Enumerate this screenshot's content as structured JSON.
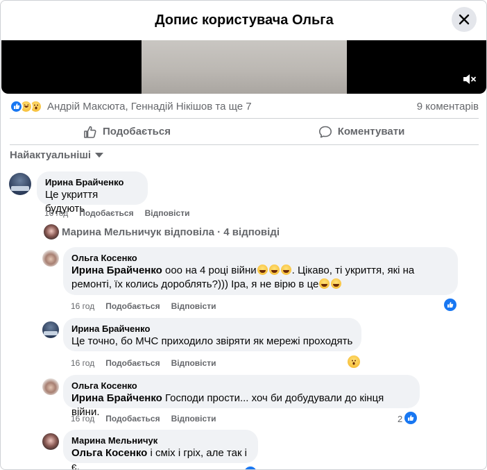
{
  "header": {
    "title": "Допис користувача Ольга"
  },
  "post": {
    "reactors": "Андрій Максюта, Геннадій Нікішов та ще 7",
    "comments_count": "9 коментарів",
    "actions": {
      "like": "Подобається",
      "comment": "Коментувати"
    },
    "sort_label": "Найактуальніші",
    "reaction_icons": [
      "like-icon",
      "laugh-icon",
      "wow-icon"
    ]
  },
  "comments": [
    {
      "author": "Ирина Брайченко",
      "text": "Це укриття будують",
      "time": "16 год",
      "like_label": "Подобається",
      "reply_label": "Відповісти"
    }
  ],
  "replies_summary": "Марина Мельничук відповіла · 4 відповіді",
  "replies": [
    {
      "author": "Ольга Косенко",
      "mention": "Ирина Брайченко",
      "text_line1": "ооо на 4 році війни",
      "text_line1_after": ". Цікаво, ті укриття, які на",
      "text_line2": "ремонті, їх колись дороблять?))) Іра, я не вірю в це",
      "time": "16 год",
      "like_label": "Подобається",
      "reply_label": "Відповісти"
    },
    {
      "author": "Ирина Брайченко",
      "text": "Це точно, бо МЧС приходило звіряти як мережі проходять",
      "time": "16 год",
      "like_label": "Подобається",
      "reply_label": "Відповісти"
    },
    {
      "author": "Ольга Косенко",
      "mention": "Ирина Брайченко",
      "text": "Господи прости... хоч би добудували до кінця війни.",
      "time": "16 год",
      "like_label": "Подобається",
      "reply_label": "Відповісти",
      "reaction_count": "2"
    },
    {
      "author": "Марина Мельничук",
      "mention": "Ольга Косенко",
      "text": "і сміх і гріх, але так і є."
    }
  ],
  "colors": {
    "like_blue": "#1877f2",
    "muted_text": "#65676b",
    "bubble_bg": "#f0f2f5"
  }
}
